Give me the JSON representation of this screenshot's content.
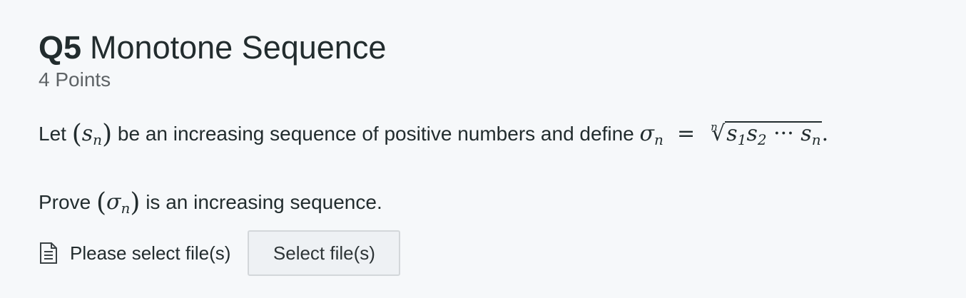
{
  "question": {
    "number": "Q5",
    "title": "Monotone Sequence",
    "points": "4 Points"
  },
  "prompt": {
    "line1_prefix": "Let",
    "line1_middle": "be an increasing sequence of positive numbers and define",
    "line2_prefix": "Prove",
    "line2_suffix": "is an increasing sequence."
  },
  "math": {
    "s": "s",
    "sigma": "σ",
    "n": "n",
    "equals": "=",
    "sub1": "1",
    "sub2": "2",
    "cdots": "···",
    "period": "."
  },
  "upload": {
    "icon": "file-text-icon",
    "label": "Please select file(s)",
    "button_label": "Select file(s)"
  }
}
